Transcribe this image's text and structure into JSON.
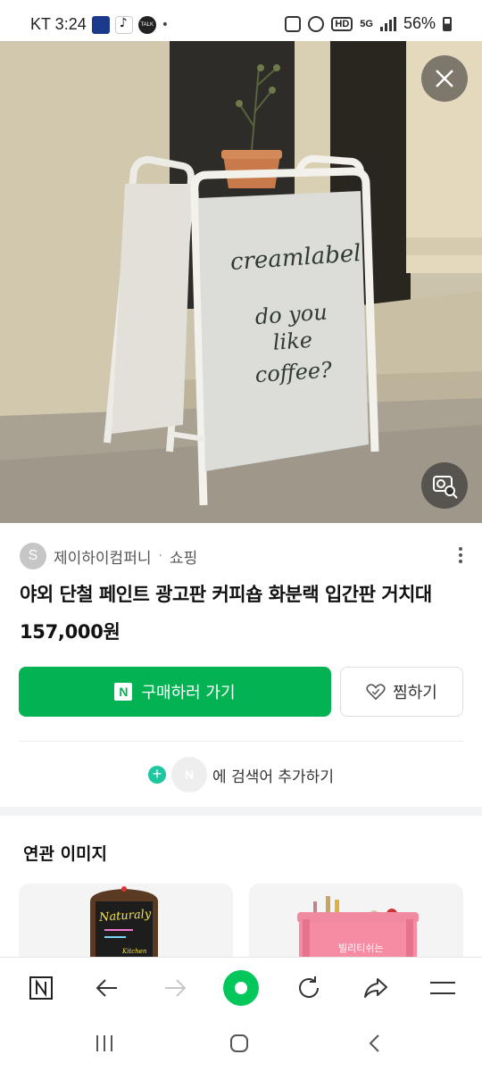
{
  "status_bar": {
    "carrier_time": "KT 3:24",
    "dot": "•",
    "talk_badge": "TALK",
    "hd_badge": "HD",
    "network_badge": "5G",
    "battery": "56%"
  },
  "hero": {
    "sign_text_line1": "creamlabel",
    "sign_text_line2": "do you",
    "sign_text_line3": "like",
    "sign_text_line4": "coffee?",
    "close_icon": "close-icon",
    "lens_icon": "image-search-icon"
  },
  "product": {
    "shop_initial": "S",
    "shop_name": "제이하이컴퍼니",
    "separator": "·",
    "category": "쇼핑",
    "title": "야외 단철 페인트 광고판 커피숍 화분랙 입간판 거치대",
    "price": "157,000원"
  },
  "actions": {
    "buy_badge": "N",
    "buy_label": "구매하러 가기",
    "save_label": "찜하기",
    "buy_color": "#03b252"
  },
  "add_search": {
    "plus": "+",
    "avatar_letter": "N",
    "label": "에 검색어 추가하기"
  },
  "related": {
    "title": "연관 이미지",
    "card1_sign": "Naturaly",
    "card1_sub": "Kitchen",
    "card2_sign": "빌리티쉬는"
  },
  "toolbar": {
    "home_icon": "naver-home-icon",
    "back_icon": "back-arrow-icon",
    "forward_icon": "forward-arrow-icon",
    "green_icon": "green-dot-icon",
    "refresh_icon": "refresh-icon",
    "share_icon": "share-icon",
    "menu_icon": "menu-icon",
    "home_letter": "N"
  }
}
